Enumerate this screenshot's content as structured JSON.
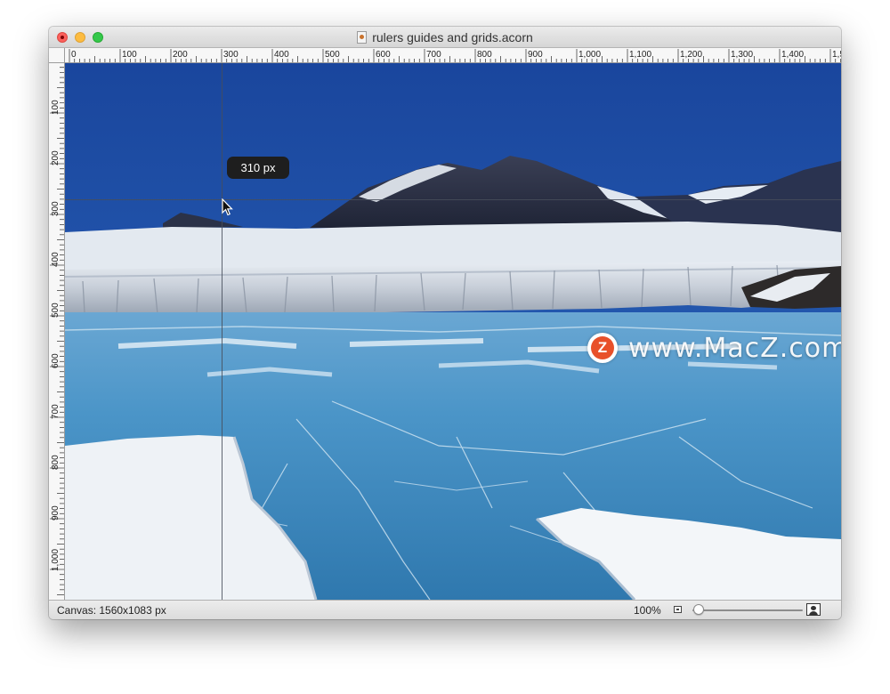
{
  "window": {
    "title": "rulers guides and grids.acorn",
    "document_icon": "acorn-document-icon"
  },
  "rulers": {
    "horizontal_labels": [
      "0",
      "100",
      "200",
      "300",
      "400",
      "500",
      "600",
      "700",
      "800",
      "900",
      "1,000",
      "1,100",
      "1,200",
      "1,300",
      "1,400",
      "1,5"
    ],
    "vertical_labels": [
      "100",
      "200",
      "300",
      "400",
      "500",
      "600",
      "700",
      "800",
      "900",
      "1,000"
    ]
  },
  "guide_tooltip": "310 px",
  "watermark": {
    "logo_letter": "Z",
    "text": "www.MacZ.com"
  },
  "statusbar": {
    "canvas_size": "Canvas: 1560x1083 px",
    "zoom": "100%",
    "zoom_slider_level": 0.0
  },
  "icons": {
    "cursor": "arrow-cursor-icon",
    "zoom_out": "small-image-icon",
    "zoom_in": "large-image-icon"
  },
  "colors": {
    "close": "#fc605c",
    "minimize": "#fdbc40",
    "zoom": "#34c84a",
    "sky": "#1d4fa6",
    "guide": "#464e5a"
  }
}
